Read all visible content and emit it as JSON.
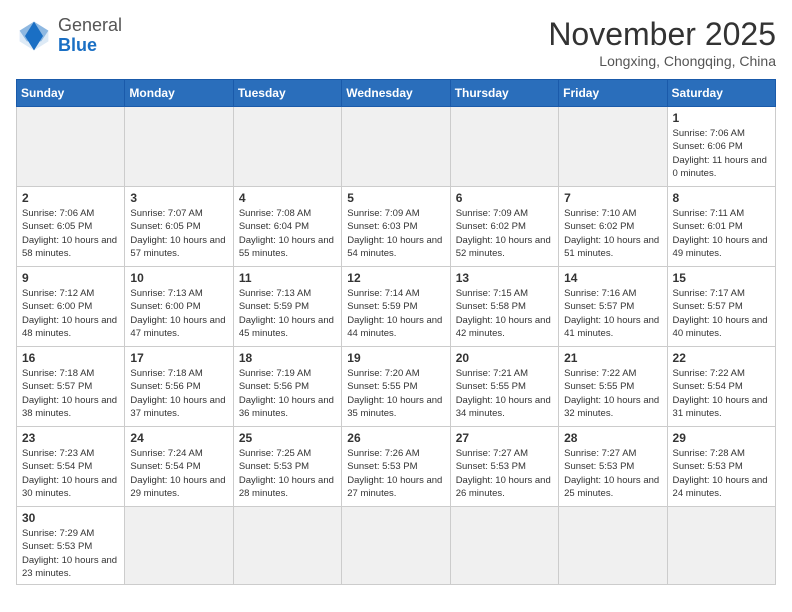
{
  "header": {
    "logo_general": "General",
    "logo_blue": "Blue",
    "title": "November 2025",
    "subtitle": "Longxing, Chongqing, China"
  },
  "days_of_week": [
    "Sunday",
    "Monday",
    "Tuesday",
    "Wednesday",
    "Thursday",
    "Friday",
    "Saturday"
  ],
  "weeks": [
    [
      {
        "day": "",
        "info": "",
        "empty": true
      },
      {
        "day": "",
        "info": "",
        "empty": true
      },
      {
        "day": "",
        "info": "",
        "empty": true
      },
      {
        "day": "",
        "info": "",
        "empty": true
      },
      {
        "day": "",
        "info": "",
        "empty": true
      },
      {
        "day": "",
        "info": "",
        "empty": true
      },
      {
        "day": "1",
        "info": "Sunrise: 7:06 AM\nSunset: 6:06 PM\nDaylight: 11 hours and 0 minutes."
      }
    ],
    [
      {
        "day": "2",
        "info": "Sunrise: 7:06 AM\nSunset: 6:05 PM\nDaylight: 10 hours and 58 minutes."
      },
      {
        "day": "3",
        "info": "Sunrise: 7:07 AM\nSunset: 6:05 PM\nDaylight: 10 hours and 57 minutes."
      },
      {
        "day": "4",
        "info": "Sunrise: 7:08 AM\nSunset: 6:04 PM\nDaylight: 10 hours and 55 minutes."
      },
      {
        "day": "5",
        "info": "Sunrise: 7:09 AM\nSunset: 6:03 PM\nDaylight: 10 hours and 54 minutes."
      },
      {
        "day": "6",
        "info": "Sunrise: 7:09 AM\nSunset: 6:02 PM\nDaylight: 10 hours and 52 minutes."
      },
      {
        "day": "7",
        "info": "Sunrise: 7:10 AM\nSunset: 6:02 PM\nDaylight: 10 hours and 51 minutes."
      },
      {
        "day": "8",
        "info": "Sunrise: 7:11 AM\nSunset: 6:01 PM\nDaylight: 10 hours and 49 minutes."
      }
    ],
    [
      {
        "day": "9",
        "info": "Sunrise: 7:12 AM\nSunset: 6:00 PM\nDaylight: 10 hours and 48 minutes."
      },
      {
        "day": "10",
        "info": "Sunrise: 7:13 AM\nSunset: 6:00 PM\nDaylight: 10 hours and 47 minutes."
      },
      {
        "day": "11",
        "info": "Sunrise: 7:13 AM\nSunset: 5:59 PM\nDaylight: 10 hours and 45 minutes."
      },
      {
        "day": "12",
        "info": "Sunrise: 7:14 AM\nSunset: 5:59 PM\nDaylight: 10 hours and 44 minutes."
      },
      {
        "day": "13",
        "info": "Sunrise: 7:15 AM\nSunset: 5:58 PM\nDaylight: 10 hours and 42 minutes."
      },
      {
        "day": "14",
        "info": "Sunrise: 7:16 AM\nSunset: 5:57 PM\nDaylight: 10 hours and 41 minutes."
      },
      {
        "day": "15",
        "info": "Sunrise: 7:17 AM\nSunset: 5:57 PM\nDaylight: 10 hours and 40 minutes."
      }
    ],
    [
      {
        "day": "16",
        "info": "Sunrise: 7:18 AM\nSunset: 5:57 PM\nDaylight: 10 hours and 38 minutes."
      },
      {
        "day": "17",
        "info": "Sunrise: 7:18 AM\nSunset: 5:56 PM\nDaylight: 10 hours and 37 minutes."
      },
      {
        "day": "18",
        "info": "Sunrise: 7:19 AM\nSunset: 5:56 PM\nDaylight: 10 hours and 36 minutes."
      },
      {
        "day": "19",
        "info": "Sunrise: 7:20 AM\nSunset: 5:55 PM\nDaylight: 10 hours and 35 minutes."
      },
      {
        "day": "20",
        "info": "Sunrise: 7:21 AM\nSunset: 5:55 PM\nDaylight: 10 hours and 34 minutes."
      },
      {
        "day": "21",
        "info": "Sunrise: 7:22 AM\nSunset: 5:55 PM\nDaylight: 10 hours and 32 minutes."
      },
      {
        "day": "22",
        "info": "Sunrise: 7:22 AM\nSunset: 5:54 PM\nDaylight: 10 hours and 31 minutes."
      }
    ],
    [
      {
        "day": "23",
        "info": "Sunrise: 7:23 AM\nSunset: 5:54 PM\nDaylight: 10 hours and 30 minutes."
      },
      {
        "day": "24",
        "info": "Sunrise: 7:24 AM\nSunset: 5:54 PM\nDaylight: 10 hours and 29 minutes."
      },
      {
        "day": "25",
        "info": "Sunrise: 7:25 AM\nSunset: 5:53 PM\nDaylight: 10 hours and 28 minutes."
      },
      {
        "day": "26",
        "info": "Sunrise: 7:26 AM\nSunset: 5:53 PM\nDaylight: 10 hours and 27 minutes."
      },
      {
        "day": "27",
        "info": "Sunrise: 7:27 AM\nSunset: 5:53 PM\nDaylight: 10 hours and 26 minutes."
      },
      {
        "day": "28",
        "info": "Sunrise: 7:27 AM\nSunset: 5:53 PM\nDaylight: 10 hours and 25 minutes."
      },
      {
        "day": "29",
        "info": "Sunrise: 7:28 AM\nSunset: 5:53 PM\nDaylight: 10 hours and 24 minutes."
      }
    ],
    [
      {
        "day": "30",
        "info": "Sunrise: 7:29 AM\nSunset: 5:53 PM\nDaylight: 10 hours and 23 minutes.",
        "last": true
      },
      {
        "day": "",
        "info": "",
        "empty": true,
        "last": true
      },
      {
        "day": "",
        "info": "",
        "empty": true,
        "last": true
      },
      {
        "day": "",
        "info": "",
        "empty": true,
        "last": true
      },
      {
        "day": "",
        "info": "",
        "empty": true,
        "last": true
      },
      {
        "day": "",
        "info": "",
        "empty": true,
        "last": true
      },
      {
        "day": "",
        "info": "",
        "empty": true,
        "last": true
      }
    ]
  ]
}
